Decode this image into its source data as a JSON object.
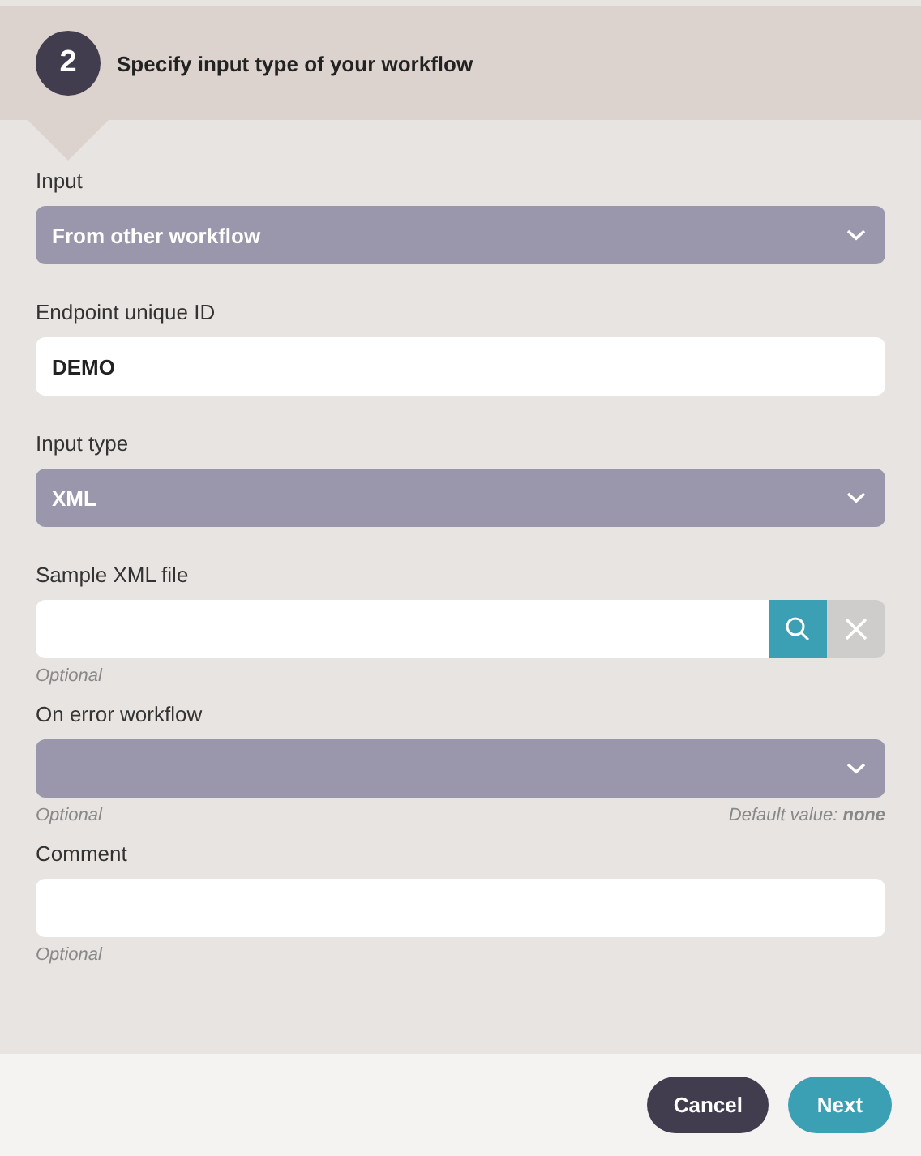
{
  "step": {
    "number": "2",
    "title": "Specify input type of your workflow"
  },
  "fields": [
    {
      "kind": "select",
      "label": "Input",
      "value": "From other workflow"
    },
    {
      "kind": "text",
      "label": "Endpoint unique ID",
      "value": "DEMO"
    },
    {
      "kind": "select",
      "label": "Input type",
      "value": "XML"
    },
    {
      "kind": "file",
      "label": "Sample XML file",
      "hint": "Optional"
    },
    {
      "kind": "select",
      "label": "On error workflow",
      "hint": "Optional",
      "default": "Default value: **none**"
    },
    {
      "kind": "text",
      "label": "Comment",
      "hint": "Optional"
    }
  ],
  "buttons": [
    {
      "label": "Cancel",
      "kind": "secondary"
    },
    {
      "label": "Next",
      "kind": "primary"
    }
  ]
}
